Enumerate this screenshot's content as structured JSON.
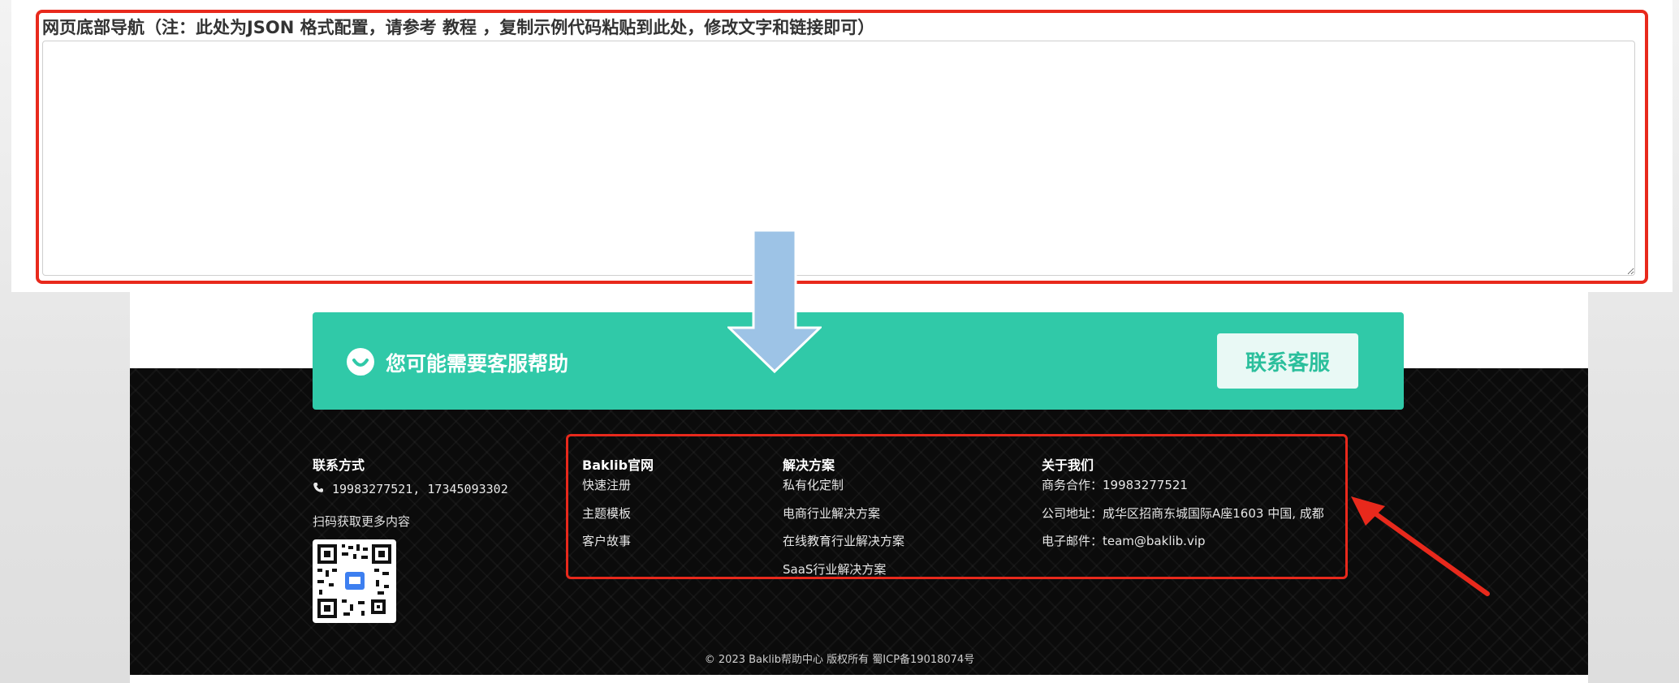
{
  "form": {
    "label": "网页底部导航（注：此处为JSON 格式配置，请参考 教程 ，复制示例代码粘贴到此处，修改文字和链接即可）",
    "textarea_value": ""
  },
  "banner": {
    "icon": "smile-chat-icon",
    "text": "您可能需要客服帮助",
    "button_label": "联系客服",
    "color": "#30c9a8"
  },
  "footer": {
    "contact": {
      "title": "联系方式",
      "phone_icon": "phone-icon",
      "phones": "19983277521, 17345093302",
      "qr_caption": "扫码获取更多内容",
      "qr_icon": "qr-code-icon"
    },
    "columns": [
      {
        "title": "Baklib官网",
        "links": [
          "快速注册",
          "主题模板",
          "客户故事"
        ]
      },
      {
        "title": "解决方案",
        "links": [
          "私有化定制",
          "电商行业解决方案",
          "在线教育行业解决方案",
          "SaaS行业解决方案"
        ]
      },
      {
        "title": "关于我们",
        "links": [
          "商务合作：19983277521",
          "公司地址：成华区招商东城国际A座1603 中国, 成都",
          "电子邮件：team@baklib.vip"
        ]
      }
    ],
    "copyright": "© 2023 Baklib帮助中心 版权所有 蜀ICP备19018074号"
  },
  "annotations": {
    "highlight_color": "#e8291c",
    "arrow_color": "#9dc3e6"
  }
}
